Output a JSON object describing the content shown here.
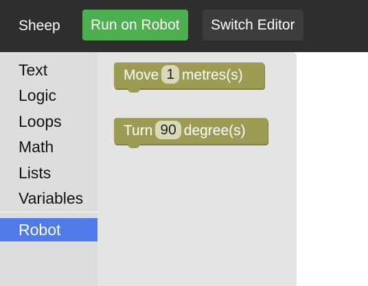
{
  "header": {
    "brand": "Sheep",
    "run_button": "Run on Robot",
    "switch_button": "Switch Editor"
  },
  "toolbox": {
    "categories": [
      {
        "label": "Text"
      },
      {
        "label": "Logic"
      },
      {
        "label": "Loops"
      },
      {
        "label": "Math"
      },
      {
        "label": "Lists"
      },
      {
        "label": "Variables"
      },
      {
        "label": "Robot",
        "selected": true
      }
    ]
  },
  "flyout": {
    "blocks": [
      {
        "prefix": "Move",
        "value": "1",
        "suffix": "metres(s)"
      },
      {
        "prefix": "Turn",
        "value": "90",
        "suffix": "degree(s)"
      }
    ]
  },
  "colors": {
    "topbar": "#2e2e2e",
    "run_button": "#4caf50",
    "switch_button": "#3c3c3c",
    "selected_category": "#4f7bea",
    "block": "#9c9c55"
  }
}
